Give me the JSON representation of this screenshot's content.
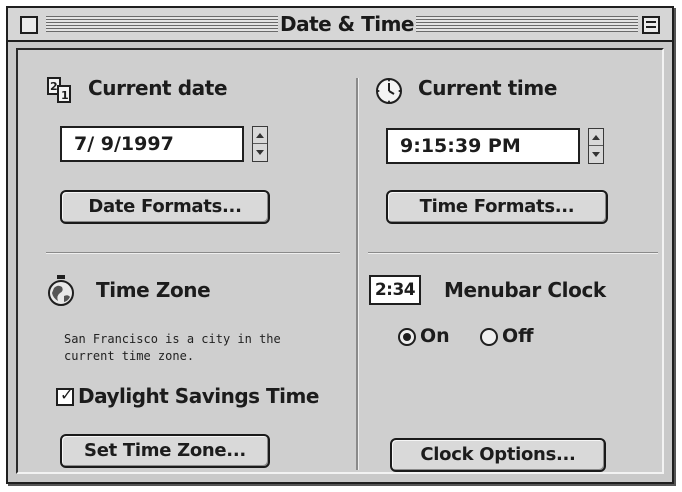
{
  "window": {
    "title": "Date & Time"
  },
  "date": {
    "heading": "Current date",
    "value": "7/ 9/1997",
    "formats_button": "Date Formats..."
  },
  "time": {
    "heading": "Current time",
    "value": "9:15:39 PM",
    "formats_button": "Time Formats..."
  },
  "time_zone": {
    "heading": "Time Zone",
    "description": "San Francisco is a city in the current time zone.",
    "daylight_label": "Daylight Savings Time",
    "daylight_checked": true,
    "set_button": "Set Time Zone..."
  },
  "menubar_clock": {
    "preview": "2:34",
    "heading": "Menubar Clock",
    "on_label": "On",
    "off_label": "Off",
    "selected": "On",
    "options_button": "Clock Options..."
  },
  "icons": [
    "close-box-icon",
    "zoom-box-icon",
    "calendar-icon",
    "clock-icon",
    "globe-icon",
    "checkmark-icon",
    "arrow-up-icon",
    "arrow-down-icon"
  ]
}
